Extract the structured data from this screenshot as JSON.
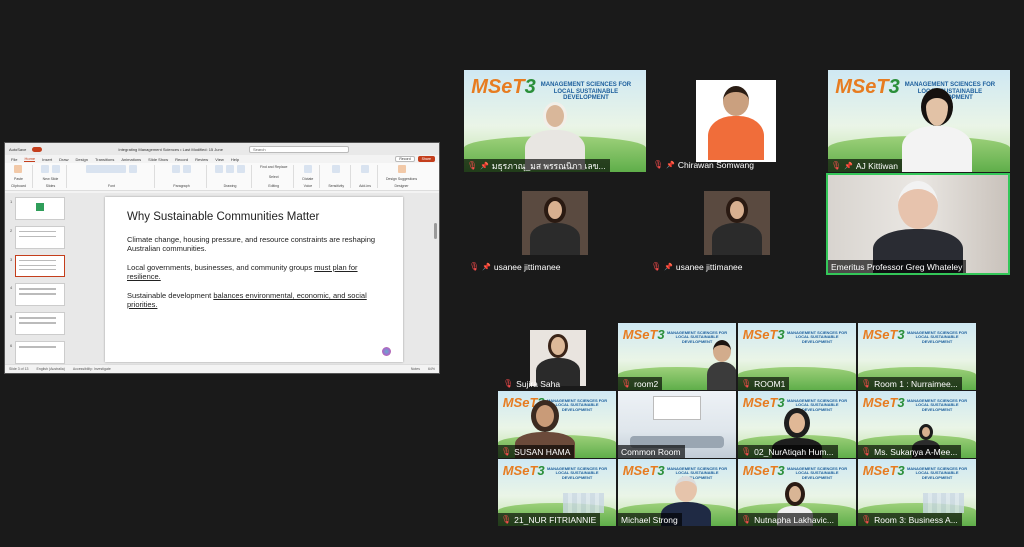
{
  "ppt": {
    "autosave_label": "AutoSave",
    "doc_title": "Integrating Management Sciences • Last Modified: 15 June",
    "search_placeholder": "Search",
    "tabs": [
      "File",
      "Home",
      "Insert",
      "Draw",
      "Design",
      "Transitions",
      "Animations",
      "Slide Show",
      "Record",
      "Review",
      "View",
      "Help"
    ],
    "active_tab": "Home",
    "record_button": "Record",
    "share_button": "Share",
    "ribbon_groups": [
      "Clipboard",
      "Slides",
      "Font",
      "Paragraph",
      "Drawing",
      "Editing",
      "Voice",
      "Sensitivity",
      "Add-ins",
      "Designer"
    ],
    "ribbon_commands": {
      "paste": "Paste",
      "new_slide": "New Slide",
      "reuse_slides": "Reuse Slides",
      "shapes": "Shapes",
      "arrange": "Arrange",
      "quick_styles": "Quick Styles",
      "find_replace": "Find and Replace",
      "select": "Select",
      "dictate": "Dictate",
      "sensitivity": "Sensitivity",
      "add_ins": "Add-ins",
      "design_ideas": "Design Suggestions"
    },
    "slide": {
      "title": "Why Sustainable Communities Matter",
      "p1": "Climate change, housing pressure, and resource constraints are reshaping Australian communities.",
      "p2_prefix": "Local governments, businesses, and community groups ",
      "p2_underlined": "must plan for resilience.",
      "p3_prefix": "Sustainable development ",
      "p3_underlined": "balances environmental, economic, and social priorities."
    },
    "status": {
      "slide_count": "Slide 3 of 13",
      "language": "English (Australia)",
      "accessibility": "Accessibility: Investigate",
      "notes": "Notes",
      "zoom": "64%"
    },
    "thumb_numbers": [
      "1",
      "2",
      "3",
      "4",
      "5",
      "6"
    ],
    "selected_thumb": 3
  },
  "banner": {
    "logo": "MSeT",
    "logo_num": "3",
    "conference": "MANAGEMENT SCIENCES FOR LOCAL SUSTAINABLE DEVELOPMENT"
  },
  "participants": [
    "มธุรภาณุ_มส พรรณนิภา เลข...",
    "Chirawan Somwang",
    "AJ Kittiwan",
    "usanee jittimanee",
    "usanee jittimanee",
    "Emeritus Professor Greg Whateley",
    "Sujira Saha",
    "room2",
    "ROOM1",
    "Room 1 : Nurraimee...",
    "SUSAN HAMA",
    "Common Room",
    "02_NurAtiqah Hum...",
    "Ms. Sukanya A-Mee...",
    "21_NUR FITRIANNIE",
    "Michael Strong",
    "Nutnapha Lakhavic...",
    "Room 3: Business A..."
  ],
  "colors": {
    "accent_ppt": "#c43e1c",
    "active_speaker": "#34c759",
    "muted_mic": "#ff4d4d"
  }
}
